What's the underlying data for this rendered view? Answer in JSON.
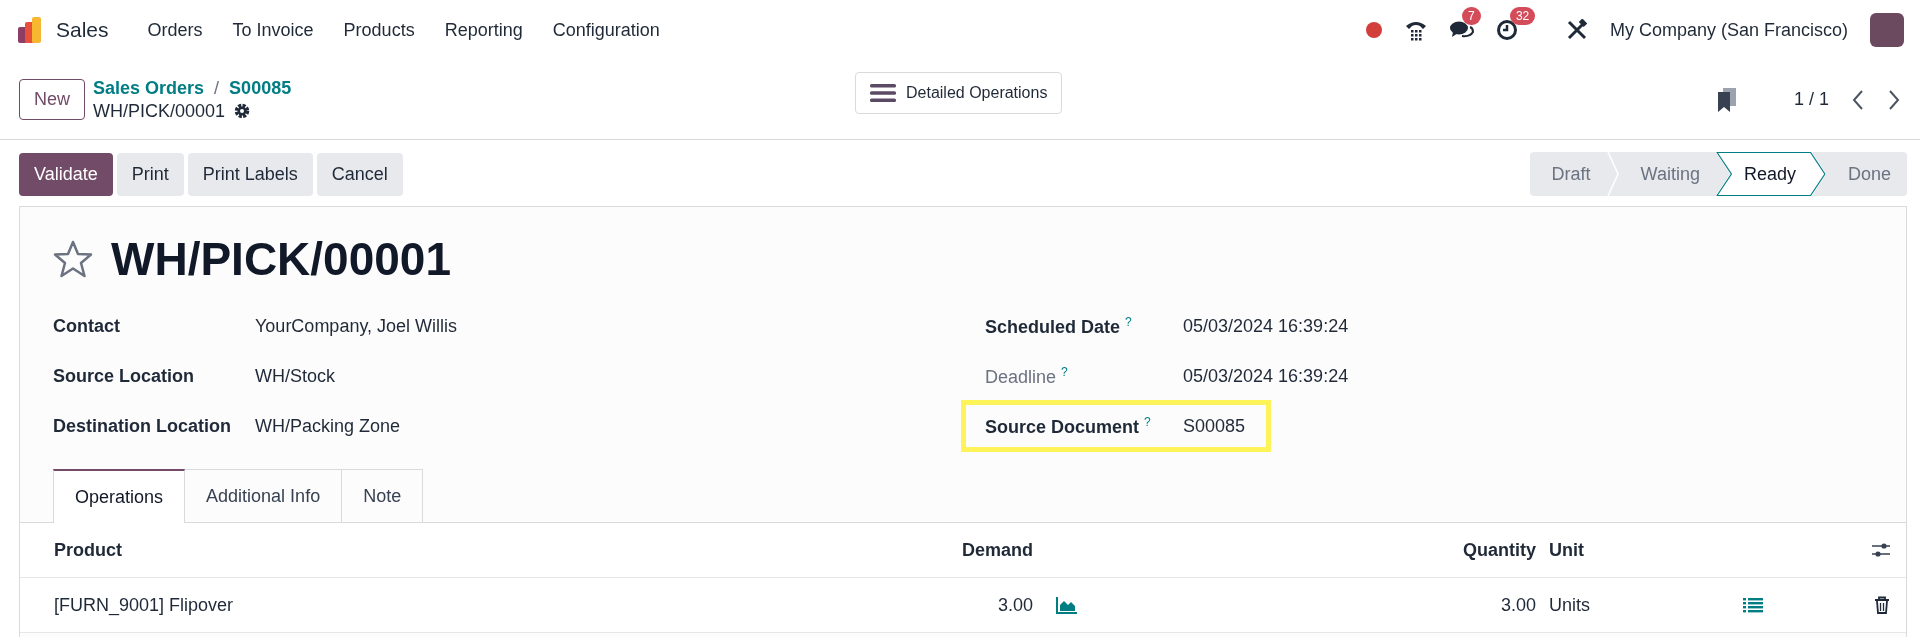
{
  "navbar": {
    "app_name": "Sales",
    "menu": [
      "Orders",
      "To Invoice",
      "Products",
      "Reporting",
      "Configuration"
    ],
    "messages_badge": "7",
    "activities_badge": "32",
    "company": "My Company (San Francisco)"
  },
  "control_panel": {
    "new_button": "New",
    "breadcrumbs": [
      "Sales Orders",
      "S00085"
    ],
    "breadcrumb_separator": "/",
    "record_name": "WH/PICK/00001",
    "center_button": "Detailed Operations",
    "pager": "1 / 1"
  },
  "actions": [
    {
      "label": "Validate",
      "primary": true
    },
    {
      "label": "Print",
      "primary": false
    },
    {
      "label": "Print Labels",
      "primary": false
    },
    {
      "label": "Cancel",
      "primary": false
    }
  ],
  "stages": [
    {
      "label": "Draft",
      "selected": false
    },
    {
      "label": "Waiting",
      "selected": false
    },
    {
      "label": "Ready",
      "selected": true
    },
    {
      "label": "Done",
      "selected": false
    }
  ],
  "record": {
    "title": "WH/PICK/00001",
    "starred": false,
    "left_fields": [
      {
        "label": "Contact",
        "value": "YourCompany, Joel Willis"
      },
      {
        "label": "Source Location",
        "value": "WH/Stock"
      },
      {
        "label": "Destination Location",
        "value": "WH/Packing Zone"
      }
    ],
    "right_fields": [
      {
        "label": "Scheduled Date",
        "help": "?",
        "value": "05/03/2024 16:39:24",
        "muted": false,
        "highlighted": false
      },
      {
        "label": "Deadline",
        "help": "?",
        "value": "05/03/2024 16:39:24",
        "muted": true,
        "highlighted": false
      },
      {
        "label": "Source Document",
        "help": "?",
        "value": "S00085",
        "muted": false,
        "highlighted": true
      }
    ]
  },
  "tabs": [
    {
      "label": "Operations",
      "selected": true
    },
    {
      "label": "Additional Info",
      "selected": false
    },
    {
      "label": "Note",
      "selected": false
    }
  ],
  "table": {
    "columns": [
      "Product",
      "Demand",
      "Quantity",
      "Unit"
    ],
    "rows": [
      {
        "product": "[FURN_9001] Flipover",
        "demand": "3.00",
        "quantity": "3.00",
        "unit": "Units"
      }
    ]
  }
}
